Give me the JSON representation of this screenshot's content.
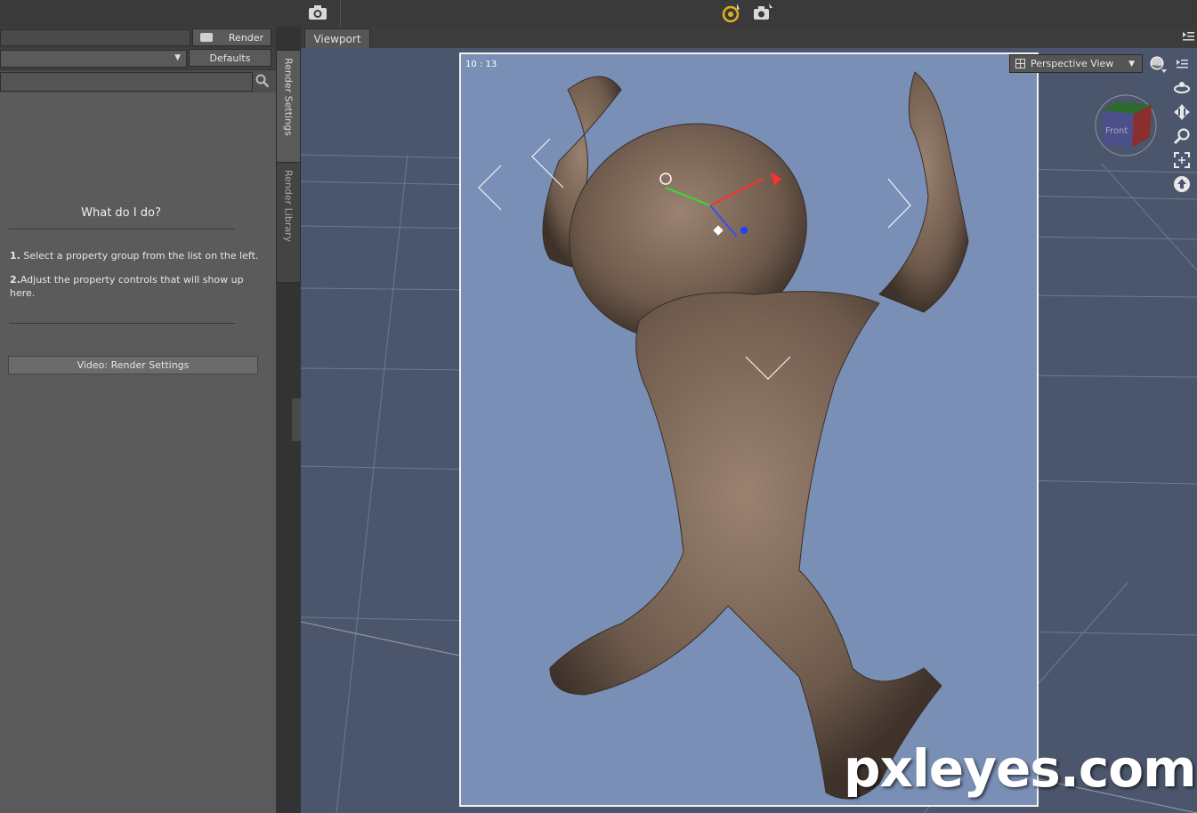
{
  "toolbar": {
    "render_label": "Render",
    "defaults_label": "Defaults"
  },
  "help": {
    "title": "What do I do?",
    "step1_num": "1.",
    "step1": "Select a property group from the list on the left.",
    "step2_num": "2.",
    "step2": "Adjust the property controls that will show up here.",
    "video_button": "Video: Render Settings"
  },
  "side_tabs": {
    "render_settings": "Render Settings",
    "render_library": "Render Library"
  },
  "viewport": {
    "tab_label": "Viewport",
    "view_select": "Perspective View",
    "frame_counter": "10 : 13",
    "cube_label": "Front"
  },
  "watermark": "pxleyes.com",
  "icons": {
    "camera": "camera-icon",
    "render_camera": "render-camera-icon",
    "search": "search-icon",
    "menu": "panel-menu-icon",
    "orbit": "orbit-icon",
    "pan": "pan-icon",
    "zoom": "zoom-icon",
    "frame": "frame-icon",
    "home": "home-icon"
  },
  "colors": {
    "viewport_bg": "#4b566c",
    "frame_bg": "#7a8fb5",
    "accent": "#e0b020"
  }
}
